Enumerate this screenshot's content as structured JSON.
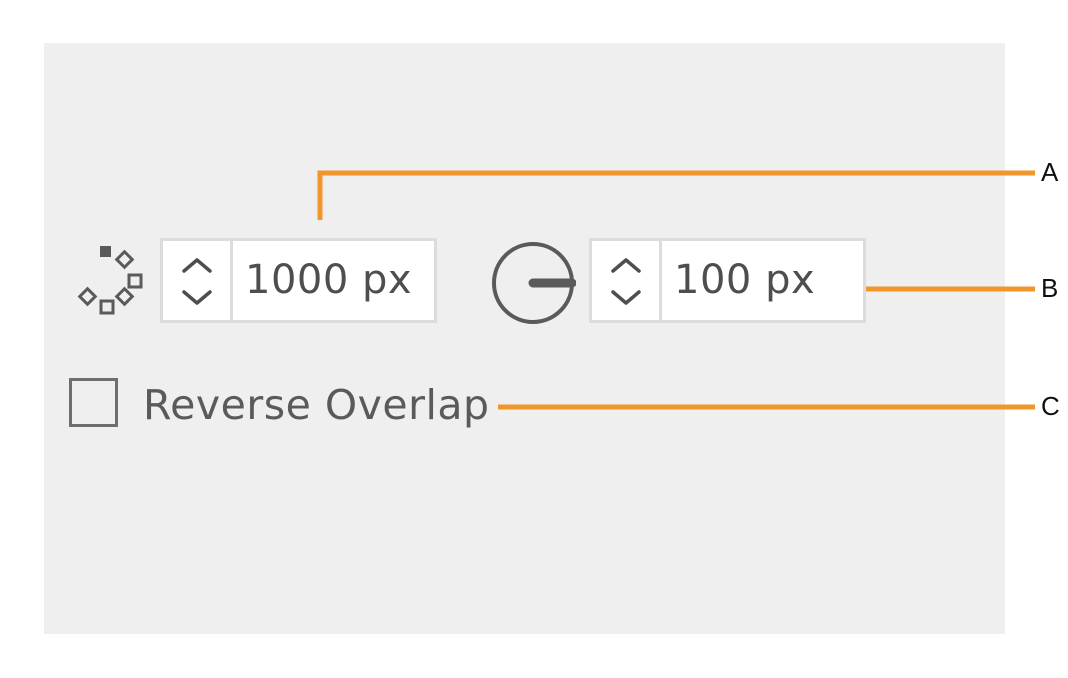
{
  "controls": {
    "stagger_icon": "stagger-icon",
    "first_stepper": {
      "value": "1000 px"
    },
    "radius_icon": "radius-icon",
    "second_stepper": {
      "value": "100 px"
    },
    "reverse_overlap": {
      "label": "Reverse Overlap",
      "checked": false
    }
  },
  "callouts": [
    {
      "label": "A"
    },
    {
      "label": "B"
    },
    {
      "label": "C"
    }
  ],
  "colors": {
    "panel": "#efefef",
    "callout_line": "#f0962b",
    "icon": "#5a5a5a"
  }
}
